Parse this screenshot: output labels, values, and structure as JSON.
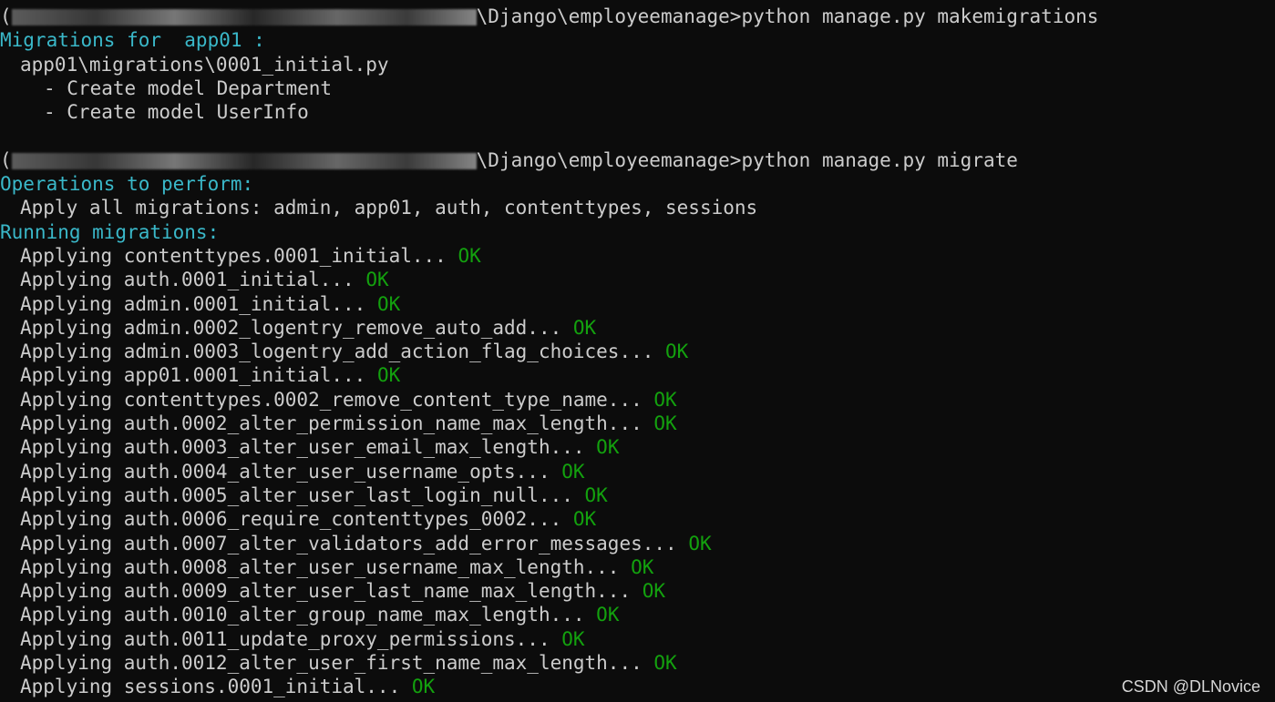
{
  "watermark": "CSDN @DLNovice",
  "colors": {
    "background": "#0c0c0c",
    "text": "#cccccc",
    "header_cyan": "#3ab8c9",
    "ok_green": "#13a10e"
  },
  "block1": {
    "prompt_prefix": "(",
    "prompt_path_tail": "\\Django\\employeemanage>",
    "command": "python manage.py makemigrations",
    "header": "Migrations for  app01 :",
    "file": "app01\\migrations\\0001_initial.py",
    "ops": [
      "- Create model Department",
      "- Create model UserInfo"
    ]
  },
  "block2": {
    "prompt_prefix": "(",
    "prompt_path_tail": "\\Django\\employeemanage>",
    "command": "python manage.py migrate",
    "operations_header": "Operations to perform:",
    "apply_all": "Apply all migrations: admin, app01, auth, contenttypes, sessions",
    "running_header": "Running migrations:",
    "migrations": [
      {
        "text": "Applying contenttypes.0001_initial...",
        "status": "OK"
      },
      {
        "text": "Applying auth.0001_initial...",
        "status": "OK"
      },
      {
        "text": "Applying admin.0001_initial...",
        "status": "OK"
      },
      {
        "text": "Applying admin.0002_logentry_remove_auto_add...",
        "status": "OK"
      },
      {
        "text": "Applying admin.0003_logentry_add_action_flag_choices...",
        "status": "OK"
      },
      {
        "text": "Applying app01.0001_initial...",
        "status": "OK"
      },
      {
        "text": "Applying contenttypes.0002_remove_content_type_name...",
        "status": "OK"
      },
      {
        "text": "Applying auth.0002_alter_permission_name_max_length...",
        "status": "OK"
      },
      {
        "text": "Applying auth.0003_alter_user_email_max_length...",
        "status": "OK"
      },
      {
        "text": "Applying auth.0004_alter_user_username_opts...",
        "status": "OK"
      },
      {
        "text": "Applying auth.0005_alter_user_last_login_null...",
        "status": "OK"
      },
      {
        "text": "Applying auth.0006_require_contenttypes_0002...",
        "status": "OK"
      },
      {
        "text": "Applying auth.0007_alter_validators_add_error_messages...",
        "status": "OK"
      },
      {
        "text": "Applying auth.0008_alter_user_username_max_length...",
        "status": "OK"
      },
      {
        "text": "Applying auth.0009_alter_user_last_name_max_length...",
        "status": "OK"
      },
      {
        "text": "Applying auth.0010_alter_group_name_max_length...",
        "status": "OK"
      },
      {
        "text": "Applying auth.0011_update_proxy_permissions...",
        "status": "OK"
      },
      {
        "text": "Applying auth.0012_alter_user_first_name_max_length...",
        "status": "OK"
      },
      {
        "text": "Applying sessions.0001_initial...",
        "status": "OK"
      }
    ]
  }
}
